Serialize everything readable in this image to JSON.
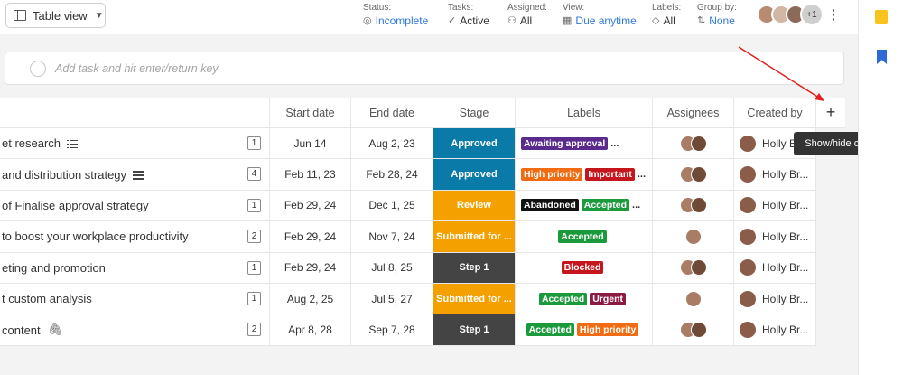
{
  "toolbar": {
    "view_label": "Table view",
    "filters": [
      {
        "label": "Status:",
        "value": "Incomplete",
        "icon": "circle-check-icon",
        "blue": true
      },
      {
        "label": "Tasks:",
        "value": "Active",
        "icon": "check-icon",
        "blue": false
      },
      {
        "label": "Assigned:",
        "value": "All",
        "icon": "people-icon",
        "blue": false
      },
      {
        "label": "View:",
        "value": "Due anytime",
        "icon": "calendar-icon",
        "blue": true
      },
      {
        "label": "Labels:",
        "value": "All",
        "icon": "tag-icon",
        "blue": false
      },
      {
        "label": "Group by:",
        "value": "None",
        "icon": "sort-icon",
        "blue": true
      }
    ],
    "avatar_more": "+1"
  },
  "add_task": {
    "placeholder": "Add task and hit enter/return key"
  },
  "columns": [
    "Start date",
    "End date",
    "Stage",
    "Labels",
    "Assignees",
    "Created by"
  ],
  "plus_glyph": "+",
  "tooltip": "Show/hide columns",
  "rows": [
    {
      "task": "et research",
      "icon": "list",
      "count": "1",
      "start": "Jun 14",
      "end": "Aug 2, 23",
      "stage": "Approved",
      "stage_color": "#0a7aa8",
      "labels": [
        {
          "text": "Awaiting approval",
          "color": "#5a2a8c"
        }
      ],
      "more": "...",
      "labels_left": true,
      "assignees": 2,
      "created_by": "Holly Br..."
    },
    {
      "task": " and distribution strategy",
      "icon": "list",
      "count": "4",
      "start": "Feb 11, 23",
      "end": "Feb 28, 24",
      "stage": "Approved",
      "stage_color": "#0a7aa8",
      "labels": [
        {
          "text": "High priority",
          "color": "#f06b12"
        },
        {
          "text": "Important",
          "color": "#c4161c"
        }
      ],
      "more": "...",
      "labels_left": true,
      "assignees": 2,
      "created_by": "Holly Br..."
    },
    {
      "task": " of Finalise approval strategy",
      "icon": "",
      "count": "1",
      "start": "Feb 29, 24",
      "end": "Dec 1, 25",
      "stage": "Review",
      "stage_color": "#f4a100",
      "labels": [
        {
          "text": "Abandoned",
          "color": "#111111"
        },
        {
          "text": "Accepted",
          "color": "#1b9a3b"
        }
      ],
      "more": "...",
      "labels_left": true,
      "assignees": 2,
      "created_by": "Holly Br..."
    },
    {
      "task": "to boost your workplace productivity",
      "icon": "",
      "count": "2",
      "start": "Feb 29, 24",
      "end": "Nov 7, 24",
      "stage": "Submitted for ...",
      "stage_color": "#f4a100",
      "labels": [
        {
          "text": "Accepted",
          "color": "#1b9a3b"
        }
      ],
      "more": "",
      "labels_left": false,
      "assignees": 1,
      "created_by": "Holly Br..."
    },
    {
      "task": "eting and promotion",
      "icon": "",
      "count": "1",
      "start": "Feb 29, 24",
      "end": "Jul 8, 25",
      "stage": "Step 1",
      "stage_color": "#444444",
      "labels": [
        {
          "text": "Blocked",
          "color": "#c4161c"
        }
      ],
      "more": "",
      "labels_left": false,
      "assignees": 2,
      "created_by": "Holly Br..."
    },
    {
      "task": "t custom analysis",
      "icon": "",
      "count": "1",
      "start": "Aug 2, 25",
      "end": "Jul 5, 27",
      "stage": "Submitted for ...",
      "stage_color": "#f4a100",
      "labels": [
        {
          "text": "Accepted",
          "color": "#1b9a3b"
        },
        {
          "text": "Urgent",
          "color": "#8c1b43"
        }
      ],
      "more": "",
      "labels_left": false,
      "assignees": 1,
      "created_by": "Holly Br..."
    },
    {
      "task": " content",
      "icon": "clip",
      "count": "2",
      "start": "Apr 8, 28",
      "end": "Sep 7, 28",
      "stage": "Step 1",
      "stage_color": "#444444",
      "labels": [
        {
          "text": "Accepted",
          "color": "#1b9a3b"
        },
        {
          "text": "High priority",
          "color": "#f06b12"
        }
      ],
      "more": "",
      "labels_left": false,
      "assignees": 2,
      "created_by": "Holly Br..."
    }
  ]
}
